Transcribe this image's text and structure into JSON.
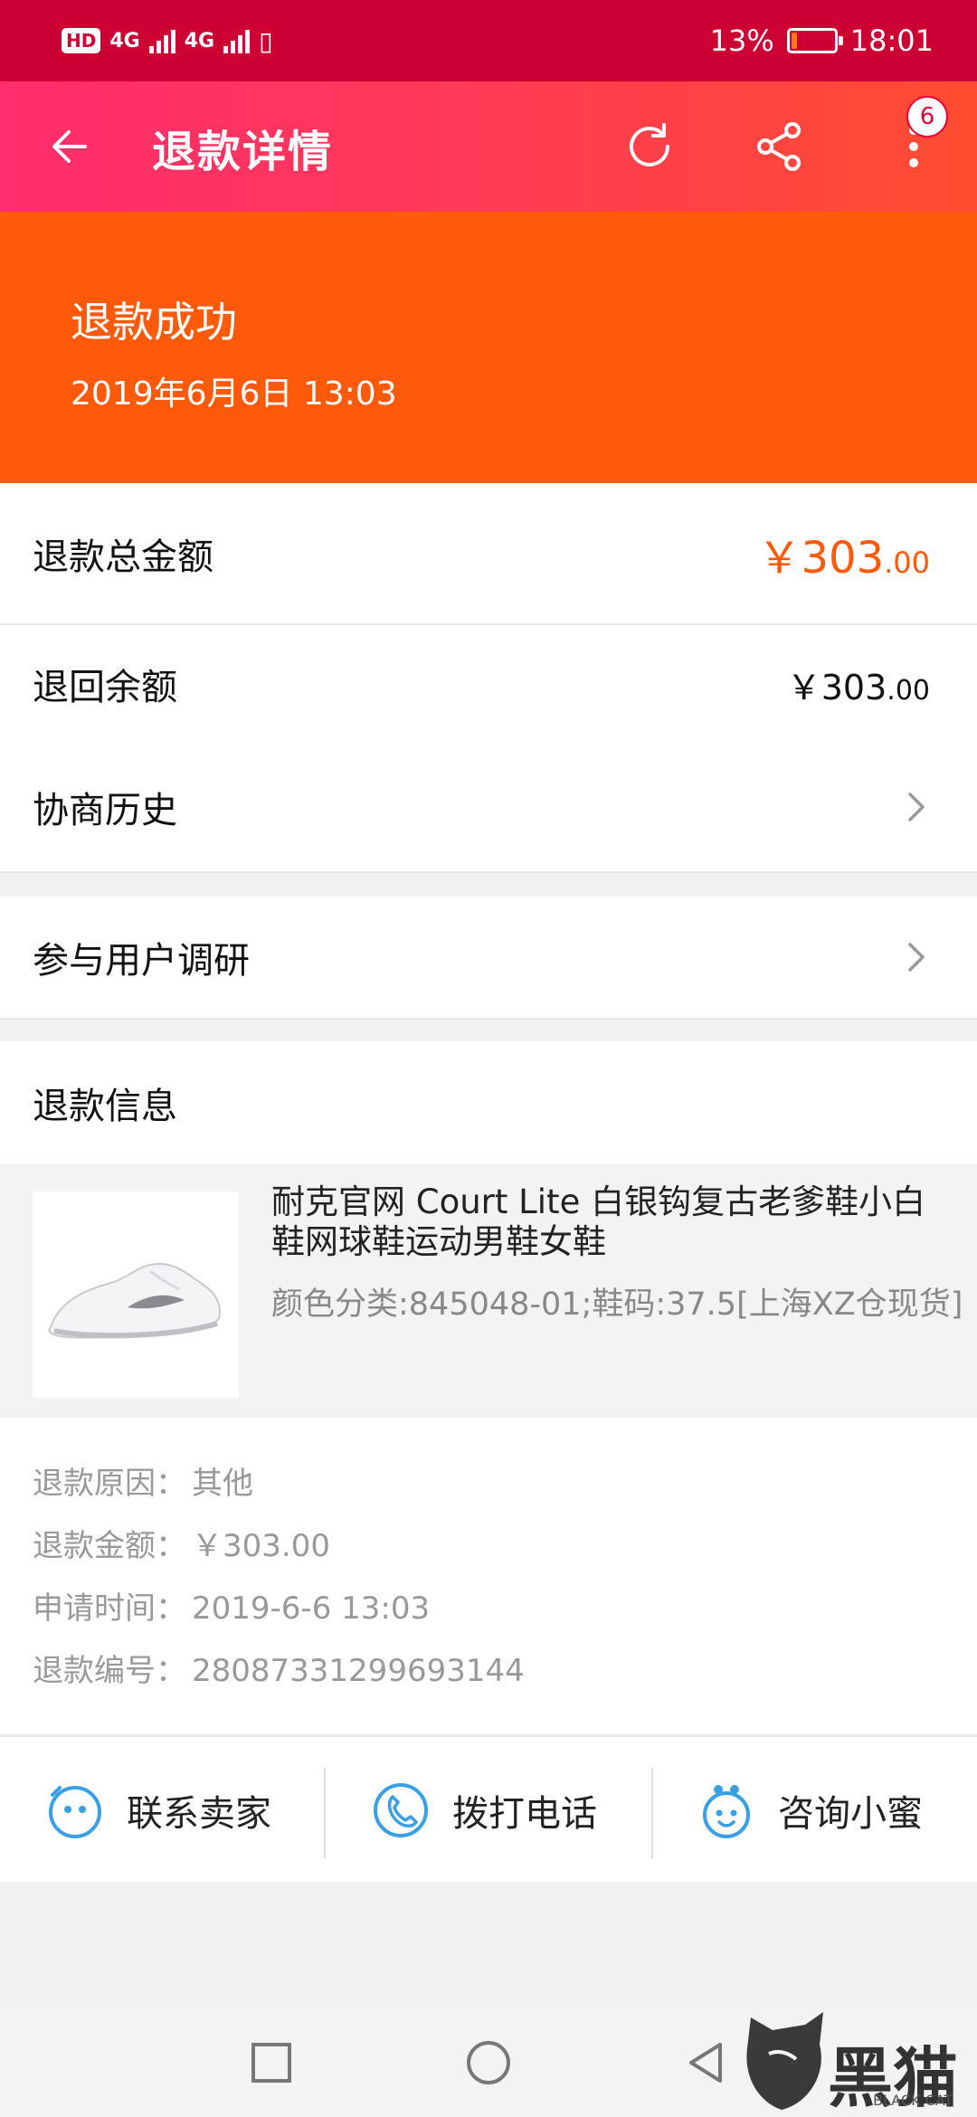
{
  "status_bar": {
    "hd": "HD",
    "net1": "4G",
    "net2": "4G",
    "battery_percent": "13%",
    "battery_level": 0.13,
    "time": "18:01"
  },
  "header": {
    "title": "退款详情",
    "badge_count": "6",
    "accent_color": "#ff3a55"
  },
  "banner": {
    "status": "退款成功",
    "time": "2019年6月6日 13:03",
    "color": "#ff5a0a"
  },
  "refund_total": {
    "label": "退款总金额",
    "currency": "￥",
    "int": "303",
    "dec": ".00"
  },
  "refund_balance": {
    "label": "退回余额",
    "currency": "￥",
    "int": "303",
    "dec": ".00"
  },
  "negotiation_history": {
    "label": "协商历史"
  },
  "user_survey": {
    "label": "参与用户调研"
  },
  "refund_info": {
    "heading": "退款信息",
    "product_title": "耐克官网 Court Lite 白银钩复古老爹鞋小白鞋网球鞋运动男鞋女鞋",
    "product_spec": "颜色分类:845048-01;鞋码:37.5[上海XZ仓现货]",
    "details": [
      {
        "label": "退款原因：",
        "value": "其他"
      },
      {
        "label": "退款金额：",
        "value": "￥303.00"
      },
      {
        "label": "申请时间：",
        "value": "2019-6-6 13:03"
      },
      {
        "label": "退款编号：",
        "value": "28087331299693144"
      }
    ]
  },
  "actions": {
    "contact_seller": "联系卖家",
    "call_phone": "拨打电话",
    "consult": "咨询小蜜"
  },
  "watermark": {
    "text": "黑猫",
    "sub": "BLACK CAT"
  }
}
